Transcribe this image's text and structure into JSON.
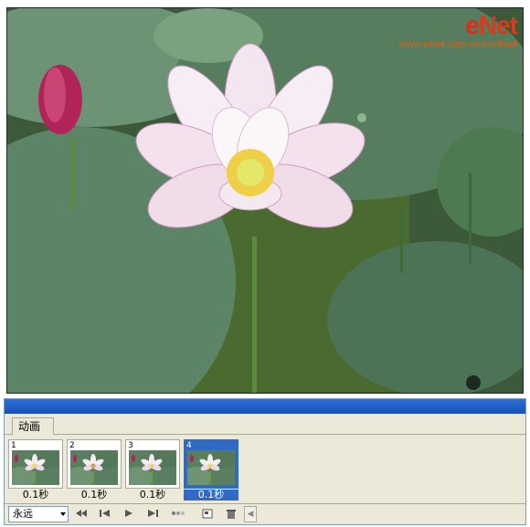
{
  "watermark": {
    "logo": "eNet",
    "url": "www.eNet.com.cn/eschool"
  },
  "palette": {
    "tab_label": "动画",
    "frames": [
      {
        "number": "1",
        "delay": "0.1秒",
        "selected": false
      },
      {
        "number": "2",
        "delay": "0.1秒",
        "selected": false
      },
      {
        "number": "3",
        "delay": "0.1秒",
        "selected": false
      },
      {
        "number": "4",
        "delay": "0.1秒",
        "selected": true
      }
    ],
    "loop_option": "永远",
    "controls": [
      {
        "icon": "first-frame-icon"
      },
      {
        "icon": "previous-frame-icon"
      },
      {
        "icon": "play-icon"
      },
      {
        "icon": "next-frame-icon"
      },
      {
        "icon": "tween-icon"
      },
      {
        "icon": "duplicate-frame-icon"
      },
      {
        "icon": "delete-frame-icon"
      }
    ]
  },
  "colors": {
    "selection": "#316ac5",
    "panel_bg": "#ece9d8",
    "title_bar": "#1a4fb8",
    "watermark_red": "#e02a1e"
  }
}
